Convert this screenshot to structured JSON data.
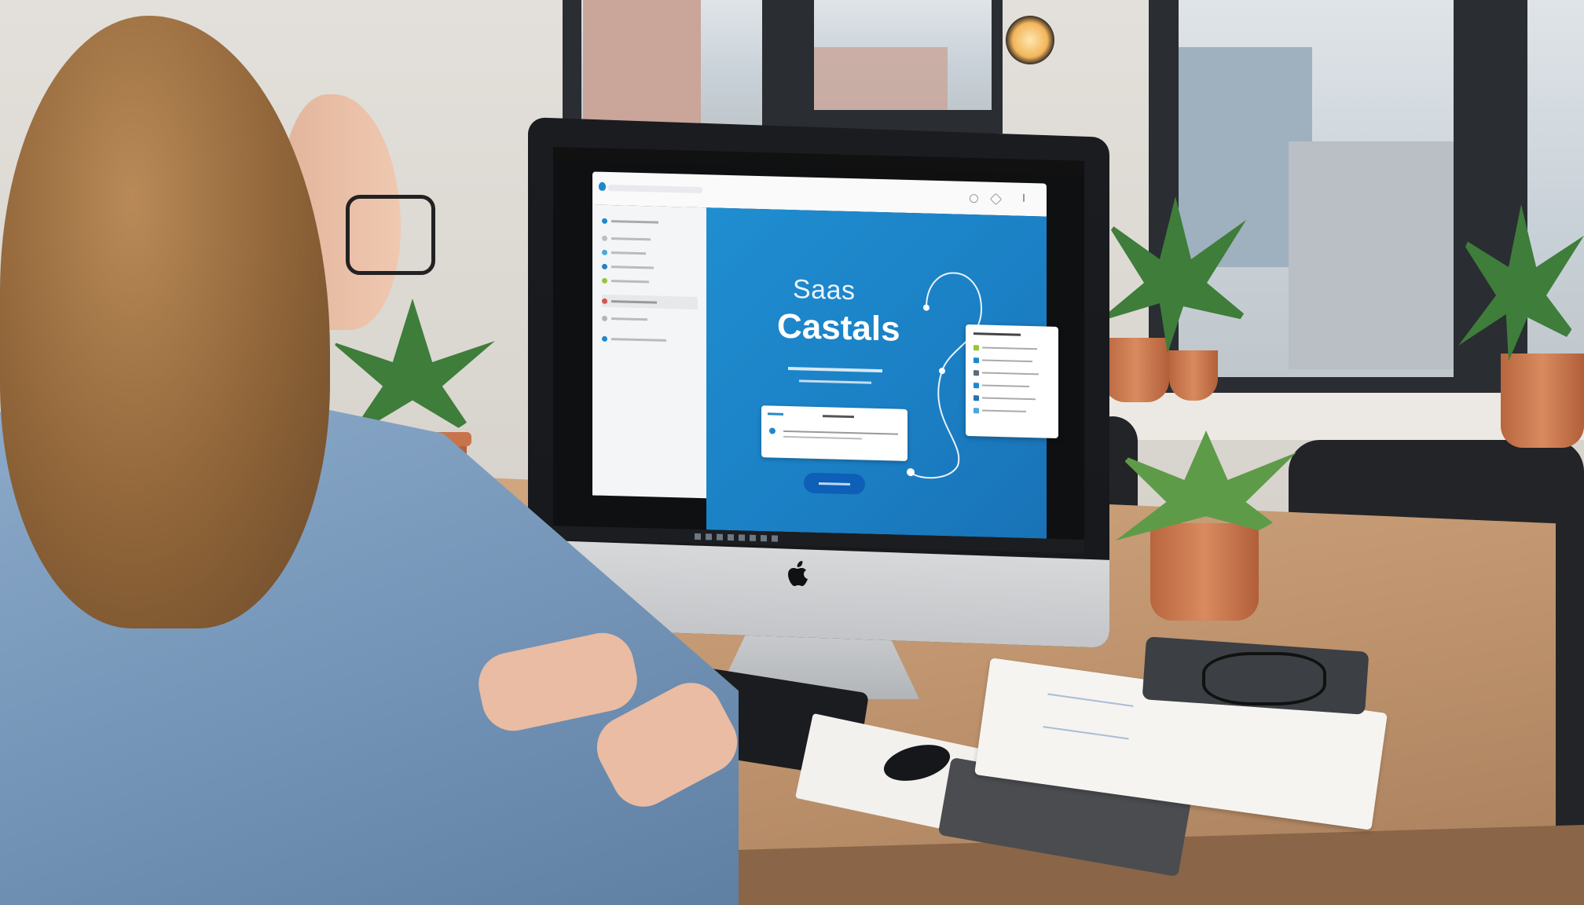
{
  "screen": {
    "hero": {
      "kicker": "Saas",
      "title": "Castals"
    }
  }
}
